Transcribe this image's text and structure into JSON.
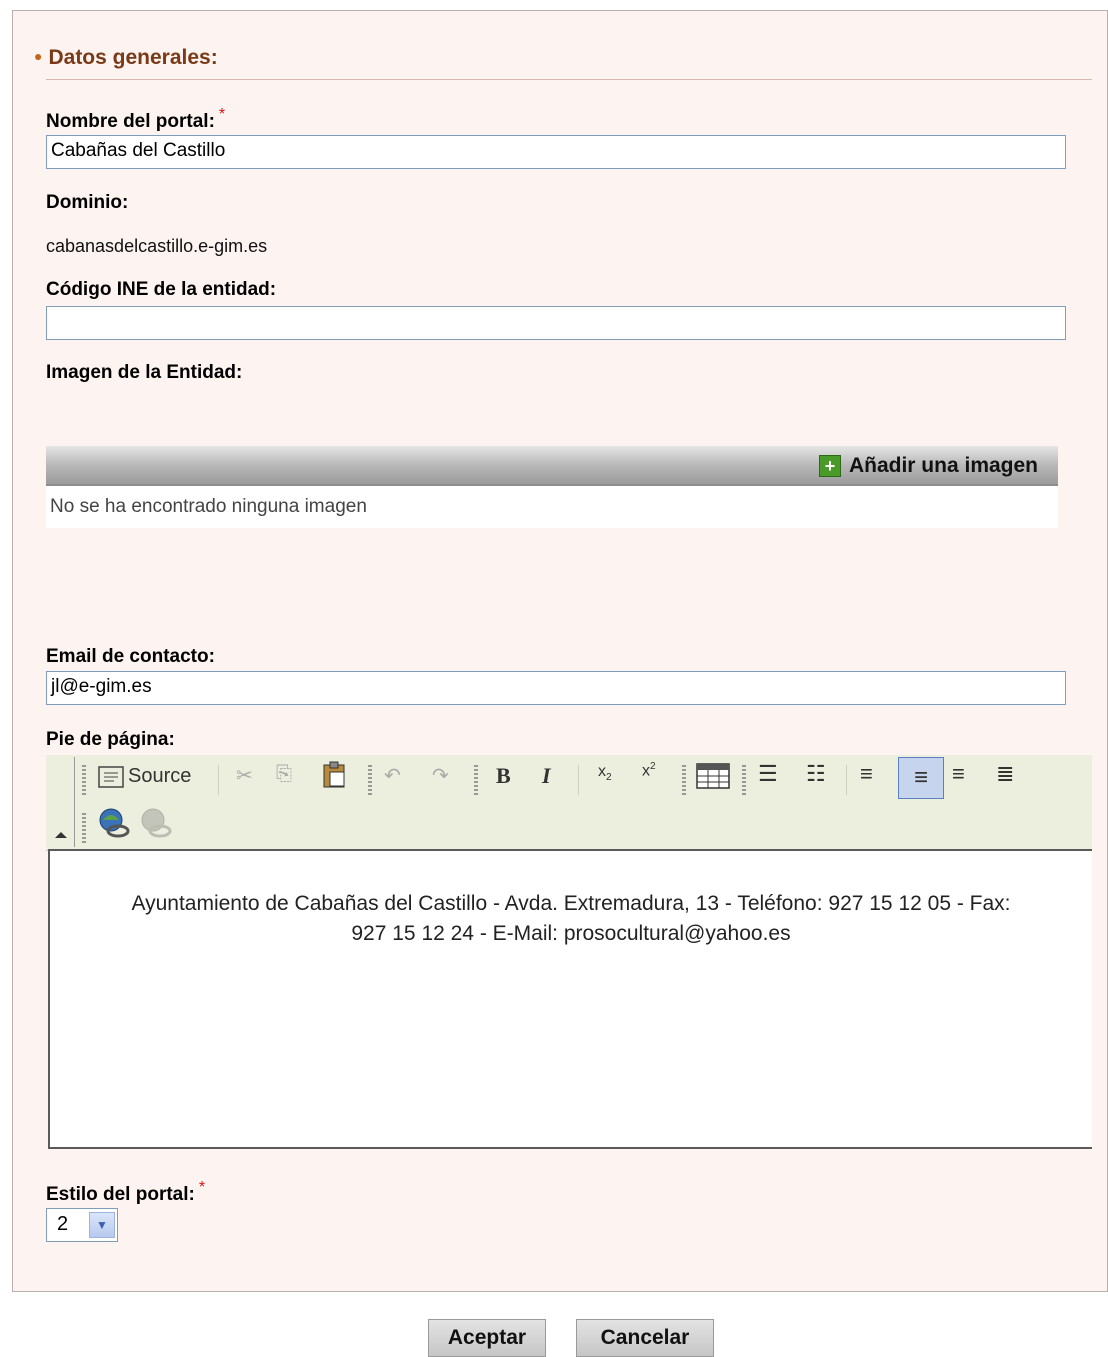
{
  "section": {
    "title": "Datos generales:"
  },
  "fields": {
    "nombre": {
      "label": "Nombre del portal:",
      "value": "Cabañas del Castillo"
    },
    "dominio": {
      "label": "Dominio:",
      "value": "cabanasdelcastillo.e-gim.es"
    },
    "ine": {
      "label": "Código INE de la entidad:",
      "value": ""
    },
    "imagen": {
      "label": "Imagen de la Entidad:",
      "add_label": "Añadir una imagen",
      "empty_text": "No se ha encontrado ninguna imagen"
    },
    "email": {
      "label": "Email de contacto:",
      "value": "jl@e-gim.es"
    },
    "pie": {
      "label": "Pie de página:",
      "source_label": "Source",
      "content_line1": "Ayuntamiento de Cabañas del Castillo - Avda. Extremadura, 13 - Teléfono: 927 15 12 05 - Fax:",
      "content_line2": "927 15 12 24 - E-Mail: prosocultural@yahoo.es"
    },
    "estilo": {
      "label": "Estilo del portal:",
      "selected": "2"
    }
  },
  "required_mark": "*",
  "buttons": {
    "accept": "Aceptar",
    "cancel": "Cancelar"
  }
}
